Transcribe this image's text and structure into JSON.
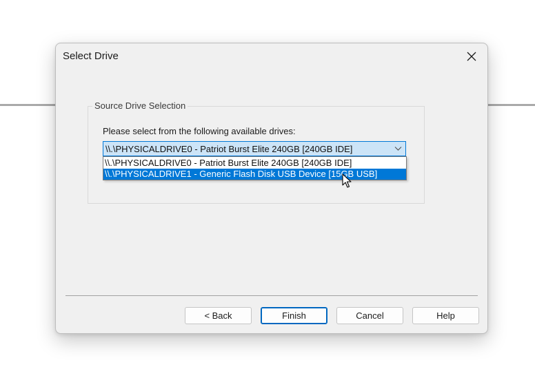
{
  "dialog": {
    "title": "Select Drive",
    "close_icon": "close-icon"
  },
  "group": {
    "label": "Source Drive Selection",
    "prompt": "Please select from the following available drives:"
  },
  "drive_combo": {
    "selected_value": "\\\\.\\PHYSICALDRIVE0 - Patriot Burst Elite 240GB [240GB IDE]",
    "arrow_icon": "chevron-down-icon",
    "options": [
      "\\\\.\\PHYSICALDRIVE0 - Patriot Burst Elite 240GB [240GB IDE]",
      "\\\\.\\PHYSICALDRIVE1 - Generic Flash Disk USB Device [15GB USB]"
    ],
    "highlighted_option_index": 1
  },
  "buttons": {
    "back": "< Back",
    "finish": "Finish",
    "cancel": "Cancel",
    "help": "Help"
  },
  "colors": {
    "accent": "#0078d7",
    "highlight_text": "#ffffff",
    "combo_background": "#cce4f7",
    "dialog_background": "#f0f0f0"
  }
}
